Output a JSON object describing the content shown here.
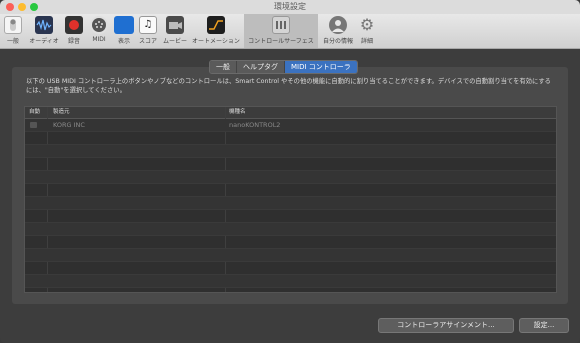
{
  "window": {
    "title": "環境設定"
  },
  "toolbar": {
    "items": [
      {
        "label": "一般",
        "icon": "switch-icon"
      },
      {
        "label": "オーディオ",
        "icon": "waveform-icon"
      },
      {
        "label": "録音",
        "icon": "record-icon"
      },
      {
        "label": "MIDI",
        "icon": "midi-port-icon"
      },
      {
        "label": "表示",
        "icon": "display-icon"
      },
      {
        "label": "スコア",
        "icon": "music-note-icon"
      },
      {
        "label": "ムービー",
        "icon": "movie-camera-icon"
      },
      {
        "label": "オートメーション",
        "icon": "automation-curve-icon"
      },
      {
        "label": "コントロールサーフェス",
        "icon": "control-surface-icon"
      },
      {
        "label": "自分の情報",
        "icon": "person-icon"
      },
      {
        "label": "詳細",
        "icon": "gear-icon"
      }
    ]
  },
  "tabs": [
    "一般",
    "ヘルプタグ",
    "MIDI コントローラ"
  ],
  "description": "以下の USB MIDI コントローラ上のボタンやノブなどのコントロールは、Smart Control やその他の機能に自動的に割り当てることができます。デバイスでの自動割り当てを有効にするには、\"自動\"を選択してください。",
  "table": {
    "headers": [
      "自動",
      "製造元",
      "機種名"
    ],
    "rows": [
      {
        "maker": "KORG INC",
        "model": "nanoKONTROL2"
      }
    ]
  },
  "buttons": {
    "assign": "コントローラアサインメント...",
    "settings": "設定..."
  },
  "colors": {
    "accent": "#3b72c0"
  }
}
